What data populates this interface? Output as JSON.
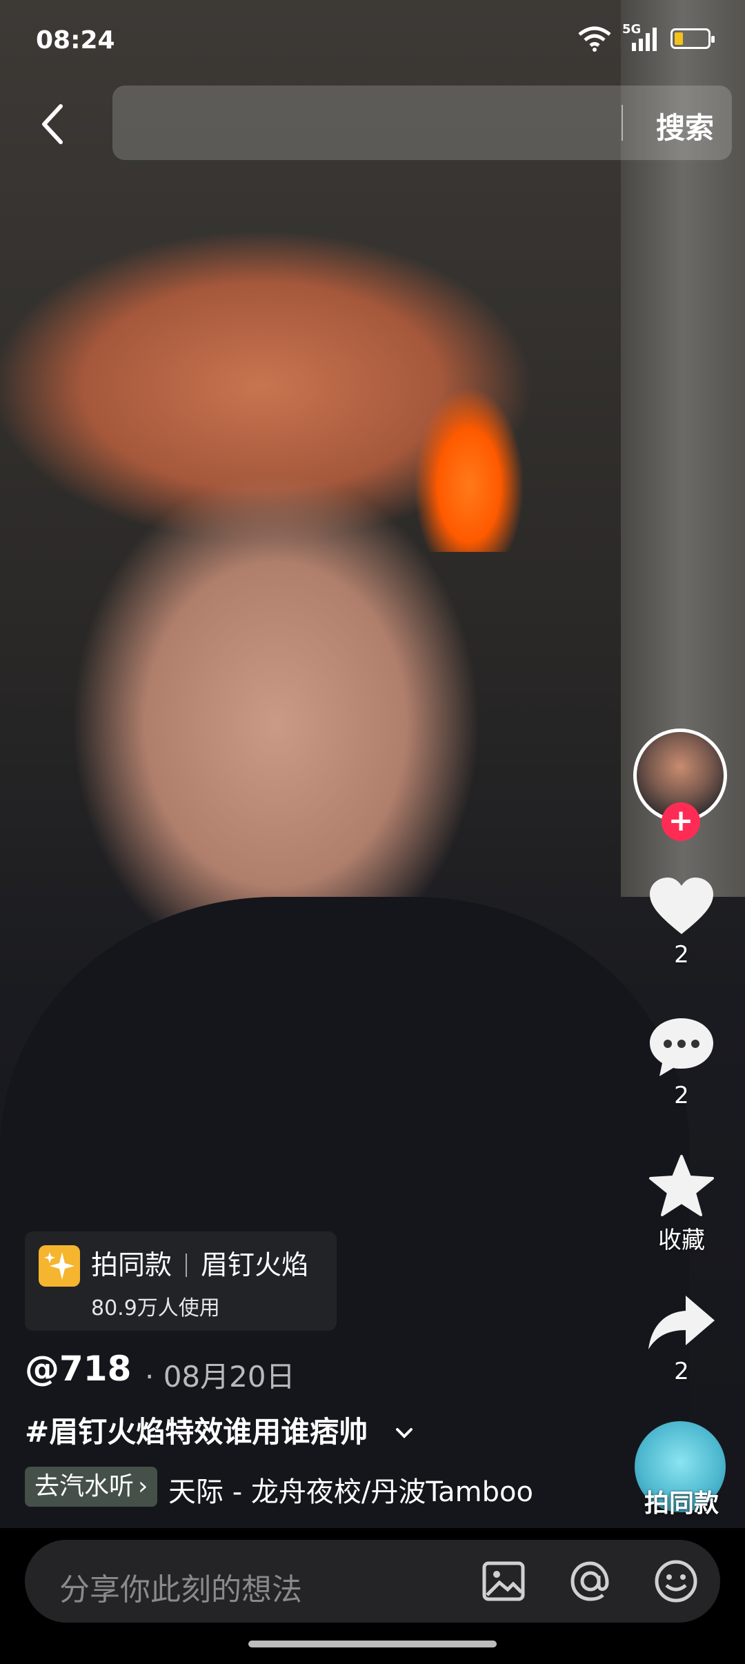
{
  "status_bar": {
    "time": "08:24",
    "network": "5G",
    "icons": [
      "wifi-icon",
      "signal-icon",
      "battery-icon"
    ],
    "battery_color": "#f4c21a"
  },
  "search": {
    "button_label": "搜索"
  },
  "right_rail": {
    "like_count": "2",
    "comment_count": "2",
    "favorite_label": "收藏",
    "share_count": "2",
    "follow_badge_color": "#fe2c55"
  },
  "template": {
    "action": "拍同款",
    "name": "眉钉火焰",
    "usage": "80.9万人使用",
    "icon_color": "#f5b52e"
  },
  "post": {
    "author": "@718",
    "date": "· 08月20日",
    "description": "#眉钉火焰特效谁用谁痞帅",
    "music_tag": "去汽水听",
    "music": "天际 - 龙舟夜校/丹波Tamboo"
  },
  "shoot_same": {
    "label": "拍同款"
  },
  "comment": {
    "placeholder": "分享你此刻的想法",
    "icons": [
      "image-icon",
      "at-icon",
      "emoji-icon"
    ]
  }
}
